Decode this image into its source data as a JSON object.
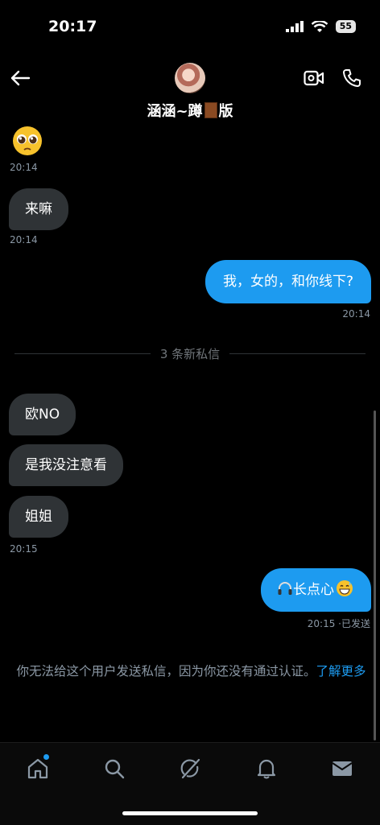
{
  "status_bar": {
    "time": "20:17",
    "battery": "55"
  },
  "header": {
    "title_prefix": "涵涵~蹲",
    "title_suffix": "版"
  },
  "messages": {
    "emoji_ts": "20:14",
    "m1": {
      "text": "来嘛",
      "time": "20:14"
    },
    "m2": {
      "text": "我，女的，和你线下?",
      "time": "20:14"
    },
    "divider": "3 条新私信",
    "m3": {
      "text": "欧NO"
    },
    "m4": {
      "text": "是我没注意看"
    },
    "m5": {
      "text": "姐姐",
      "time": "20:15"
    },
    "m6": {
      "text": "长点心",
      "time": "20:15",
      "status": "·已发送"
    }
  },
  "notice": {
    "text": "你无法给这个用户发送私信，因为你还没有通过认证。",
    "link": "了解更多"
  },
  "tabs": [
    {
      "name": "home-icon",
      "badge": true
    },
    {
      "name": "search-icon"
    },
    {
      "name": "grok-icon"
    },
    {
      "name": "bell-icon"
    },
    {
      "name": "mail-icon"
    }
  ],
  "colors": {
    "accent": "#1d9bf0",
    "bubble_in": "#2f3336",
    "background": "#000000"
  }
}
